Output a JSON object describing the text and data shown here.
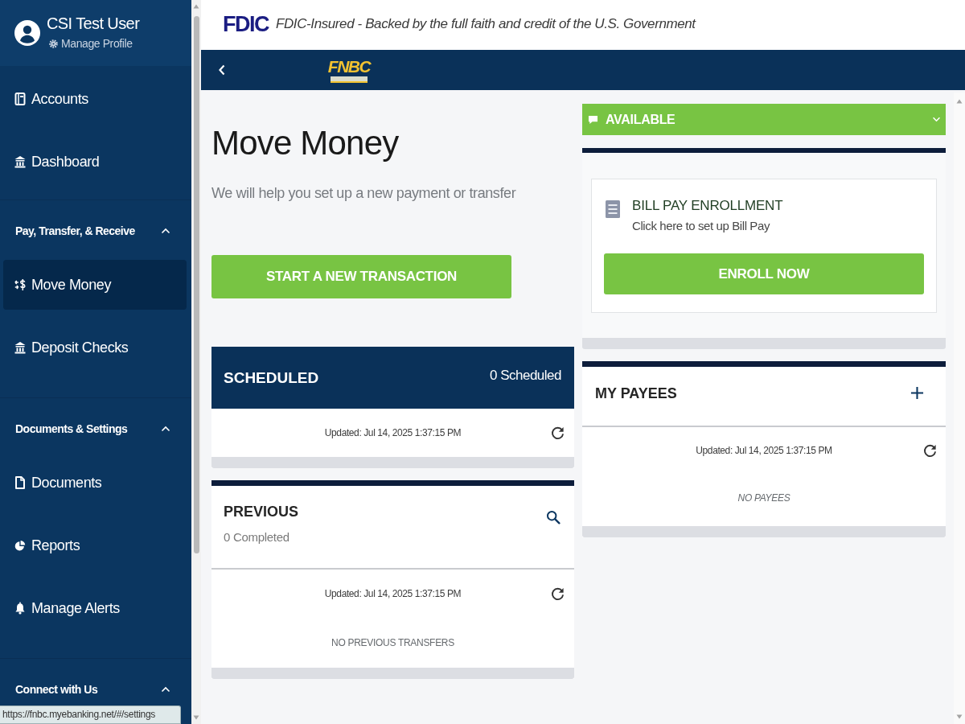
{
  "sidebar": {
    "profile": {
      "name": "CSI Test User",
      "link": "Manage Profile"
    },
    "sections": [
      {
        "items": [
          {
            "label": "Accounts",
            "selected": false
          },
          {
            "label": "Dashboard",
            "selected": false
          }
        ]
      },
      {
        "title": "Pay, Transfer, & Receive",
        "expanded": true,
        "items": [
          {
            "label": "Move Money",
            "selected": true
          },
          {
            "label": "Deposit Checks",
            "selected": false
          }
        ]
      },
      {
        "title": "Documents & Settings",
        "expanded": true,
        "items": [
          {
            "label": "Documents",
            "selected": false
          },
          {
            "label": "Reports",
            "selected": false
          },
          {
            "label": "Manage Alerts",
            "selected": false
          }
        ]
      },
      {
        "title": "Connect with Us",
        "expanded": true
      }
    ]
  },
  "banner": {
    "logo": "FDIC",
    "text": "FDIC-Insured - Backed by the full faith and credit of the U.S. Government"
  },
  "header": {
    "logo": "FNBC"
  },
  "page": {
    "title": "Move Money",
    "subtitle": "We will help you set up a new payment or transfer",
    "action": "START A NEW TRANSACTION"
  },
  "scheduled": {
    "title": "SCHEDULED",
    "count": "0 Scheduled",
    "updated": "Updated: Jul 14, 2025 1:37:15 PM"
  },
  "previous": {
    "title": "PREVIOUS",
    "count": "0 Completed",
    "updated": "Updated: Jul 14, 2025 1:37:15 PM",
    "empty": "NO PREVIOUS TRANSFERS"
  },
  "available": {
    "label": "AVAILABLE",
    "expanded": false
  },
  "bill_pay": {
    "title": "BILL PAY ENROLLMENT",
    "text": "Click here to set up Bill Pay",
    "button": "ENROLL NOW"
  },
  "payees": {
    "title": "MY PAYEES",
    "updated": "Updated: Jul 14, 2025 1:37:15 PM",
    "empty": "NO PAYEES"
  },
  "status_bar": {
    "url": "https://fnbc.myebanking.net/#/settings"
  }
}
